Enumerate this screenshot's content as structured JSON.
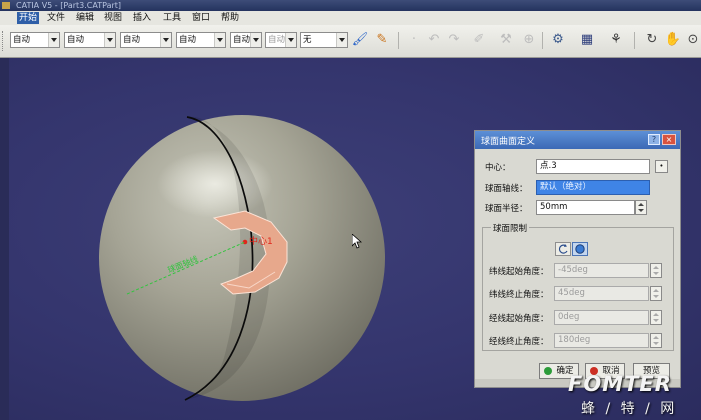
{
  "window": {
    "title": "CATIA V5 - [Part3.CATPart]"
  },
  "menubar": {
    "items": [
      "开始",
      "文件",
      "编辑",
      "视图",
      "插入",
      "工具",
      "窗口",
      "帮助"
    ]
  },
  "toolbar": {
    "combos": [
      "自动",
      "自动",
      "自动",
      "自动",
      "自动",
      "自动",
      "无"
    ]
  },
  "viewport": {
    "point_label": "中心1",
    "axis_label": "球面轴线"
  },
  "dialog": {
    "title": "球面曲面定义",
    "help_icon": "?",
    "close_icon": "×",
    "center": {
      "label": "中心：",
      "value": "点.3"
    },
    "axis": {
      "label": "球面轴线：",
      "value": "默认（绝对）"
    },
    "radius": {
      "label": "球面半径：",
      "value": "50mm"
    },
    "limits": {
      "legend": "球面限制",
      "rows": [
        {
          "label": "纬线起始角度：",
          "value": "-45deg"
        },
        {
          "label": "纬线终止角度：",
          "value": "45deg"
        },
        {
          "label": "经线起始角度：",
          "value": "0deg"
        },
        {
          "label": "经线终止角度：",
          "value": "180deg"
        }
      ]
    },
    "buttons": {
      "ok": "确定",
      "cancel": "取消",
      "preview": "预览"
    }
  },
  "watermark": {
    "brand": "FOMTER",
    "site": "蜂 / 特 / 网"
  },
  "colors": {
    "viewport_bg": "#34356d",
    "dialog_bg": "#d9d9d2",
    "title_blue": "#3b69b5",
    "selection_blue": "#3f84e6",
    "sphere": "#a5a495",
    "patch": "#e7a88c"
  }
}
